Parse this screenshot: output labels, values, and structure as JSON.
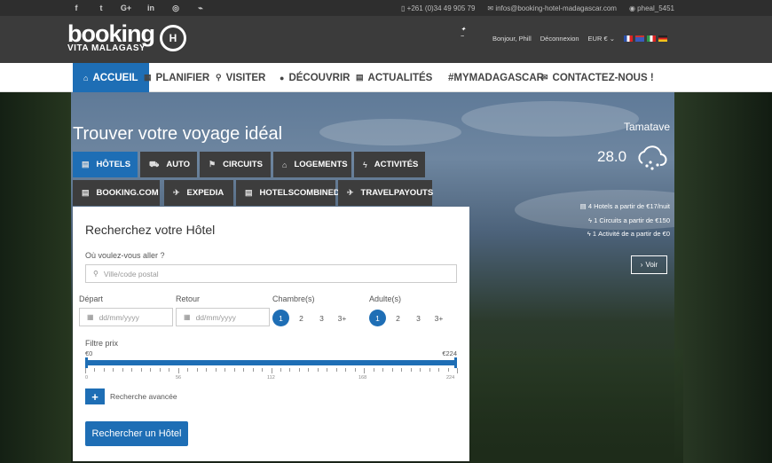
{
  "topbar": {
    "social": [
      "f",
      "t",
      "G+",
      "in",
      "◎",
      "⌁"
    ],
    "phone": "+261 (0)34 49 905 79",
    "email": "infos@booking-hotel-madagascar.com",
    "skype": "pheal_5451"
  },
  "header": {
    "logo_main": "booking",
    "logo_sub": "VITA MALAGASY",
    "logo_badge": "H",
    "greeting": "Bonjour, Phill",
    "logout": "Déconnexion",
    "currency": "EUR €",
    "flags": [
      "#3a5bbd",
      "#c33",
      "#2e9a4a",
      "#222"
    ]
  },
  "nav": {
    "items": [
      {
        "label": "ACCUEIL",
        "icon": "home-icon",
        "glyph": "⌂"
      },
      {
        "label": "PLANIFIER",
        "icon": "calendar-icon",
        "glyph": "▦"
      },
      {
        "label": "VISITER",
        "icon": "pin-icon",
        "glyph": "⚲"
      },
      {
        "label": "DÉCOUVRIR",
        "icon": "globe-icon",
        "glyph": "●"
      },
      {
        "label": "ACTUALITÉS",
        "icon": "news-icon",
        "glyph": "▤"
      },
      {
        "label": "#MYMADAGASCAR",
        "icon": "",
        "glyph": ""
      },
      {
        "label": "CONTACTEZ-NOUS !",
        "icon": "mail-icon",
        "glyph": "✉"
      }
    ]
  },
  "hero": {
    "title": "Trouver votre voyage idéal",
    "tabs_row1": [
      {
        "label": "HÔTELS",
        "glyph": "▤"
      },
      {
        "label": "AUTO",
        "glyph": "⛟"
      },
      {
        "label": "CIRCUITS",
        "glyph": "⚑"
      },
      {
        "label": "LOGEMENTS",
        "glyph": "⌂"
      },
      {
        "label": "ACTIVITÉS",
        "glyph": "ϟ"
      }
    ],
    "tabs_row2": [
      {
        "label": "BOOKING.COM",
        "glyph": "▤"
      },
      {
        "label": "EXPEDIA",
        "glyph": "✈"
      },
      {
        "label": "HOTELSCOMBINED",
        "glyph": "▤"
      },
      {
        "label": "TRAVELPAYOUTS",
        "glyph": "✈"
      }
    ]
  },
  "form": {
    "title": "Recherchez votre Hôtel",
    "destination_label": "Où voulez-vous aller ?",
    "destination_placeholder": "Ville/code postal",
    "depart_label": "Départ",
    "retour_label": "Retour",
    "date_placeholder": "dd/mm/yyyy",
    "rooms_label": "Chambre(s)",
    "adults_label": "Adulte(s)",
    "counts": [
      "1",
      "2",
      "3",
      "3+"
    ],
    "price_label": "Filtre prix",
    "price_min": "€0",
    "price_max": "€224",
    "price_range_selected": [
      0,
      224
    ],
    "ticks": [
      "0",
      "56",
      "112",
      "168",
      "224"
    ],
    "advanced": "Recherche avancée",
    "submit": "Rechercher un Hôtel"
  },
  "weather": {
    "city": "Tamatave",
    "temp": "28.0",
    "icon": "cloud-snow-icon",
    "lines": [
      {
        "glyph": "▤",
        "text": "4 Hotels a partir de €17/nuit"
      },
      {
        "glyph": "ϟ",
        "text": "1 Circuits a partir de €150"
      },
      {
        "glyph": "ϟ",
        "text": "1 Activité de a partir de €0"
      }
    ],
    "voir": "Voir"
  },
  "accent_color": "#1e6eb5"
}
